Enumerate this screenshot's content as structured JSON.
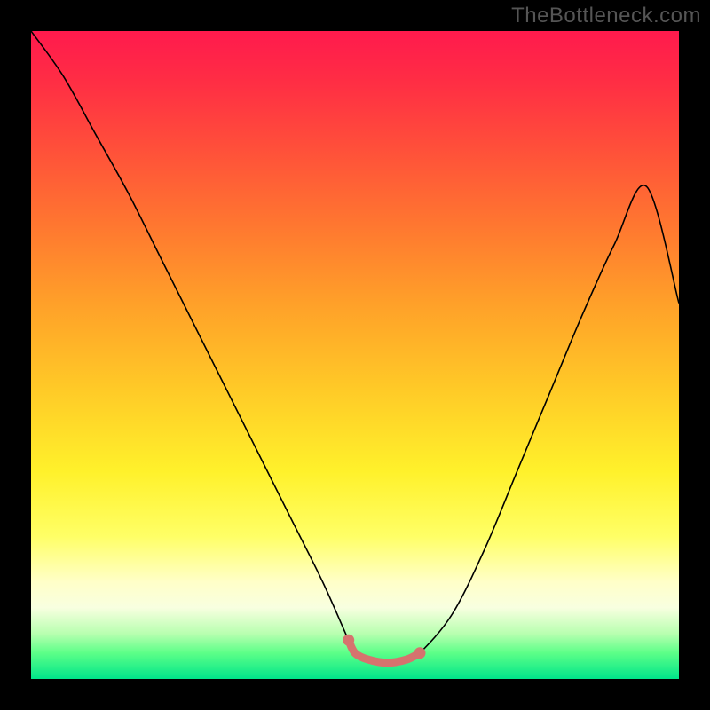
{
  "watermark": "TheBottleneck.com",
  "chart_data": {
    "type": "line",
    "title": "",
    "xlabel": "",
    "ylabel": "",
    "xlim": [
      0,
      100
    ],
    "ylim": [
      0,
      100
    ],
    "x": [
      0,
      5,
      10,
      15,
      20,
      25,
      30,
      35,
      40,
      45,
      49,
      50,
      52,
      55,
      58,
      60,
      65,
      70,
      75,
      80,
      85,
      90,
      95,
      100
    ],
    "y": [
      100,
      93,
      84,
      75,
      65,
      55,
      45,
      35,
      25,
      15,
      6,
      4,
      3,
      2.5,
      3,
      4,
      10,
      20,
      32,
      44,
      56,
      67,
      76,
      58
    ],
    "series": [
      {
        "name": "bottleneck-curve",
        "color": "#000000",
        "x": [
          0,
          5,
          10,
          15,
          20,
          25,
          30,
          35,
          40,
          45,
          49,
          50,
          52,
          55,
          58,
          60,
          65,
          70,
          75,
          80,
          85,
          90,
          95,
          100
        ],
        "y": [
          100,
          93,
          84,
          75,
          65,
          55,
          45,
          35,
          25,
          15,
          6,
          4,
          3,
          2.5,
          3,
          4,
          10,
          20,
          32,
          44,
          56,
          67,
          76,
          58
        ]
      },
      {
        "name": "optimal-zone-highlight",
        "color": "#d6736e",
        "x": [
          49,
          50,
          52,
          55,
          58,
          60
        ],
        "y": [
          6,
          4,
          3,
          2.5,
          3,
          4
        ]
      }
    ],
    "background_gradient": {
      "orientation": "vertical",
      "stops": [
        {
          "pos": 0.0,
          "color": "#ff1a4d"
        },
        {
          "pos": 0.3,
          "color": "#ff7730"
        },
        {
          "pos": 0.55,
          "color": "#ffc927"
        },
        {
          "pos": 0.78,
          "color": "#ffff66"
        },
        {
          "pos": 0.89,
          "color": "#f8ffe0"
        },
        {
          "pos": 1.0,
          "color": "#00e58a"
        }
      ]
    }
  }
}
